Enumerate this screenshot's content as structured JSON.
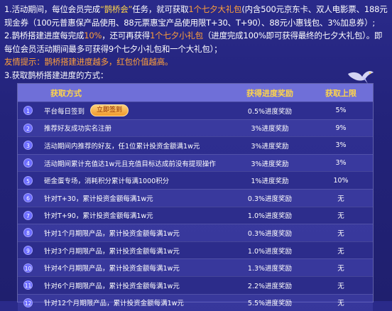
{
  "rules": {
    "line1_a": "1.活动期间，每位会员完成",
    "line1_event": "“鹊桥会”",
    "line1_b": "任务，就可获取",
    "line1_prize": "1个七夕大礼包",
    "line1_c": "(内含500元京东卡、双人电影票、188元现金券（100元普惠保产品使用、88元票惠宝产品使用限T+30、T+90）、88元小惠钱包、3%加息券）;",
    "line2_a": "2.鹊桥搭建进度每完成",
    "line2_pct": "10%",
    "line2_b": "，还可再获得",
    "line2_prize": "1个七夕小礼包",
    "line2_c": "（进度完成100%即可获得最终的七夕大礼包）。即每位会员活动期间最多可获得9个七夕小礼包和一个大礼包）；",
    "tip": "友情提示：鹊桥搭建进度越多，红包价值越高。",
    "line3": "3.获取鹊桥搭建进度的方式："
  },
  "table": {
    "headers": {
      "method": "获取方式",
      "reward": "获得进度奖励",
      "limit": "获取上限"
    },
    "signin_button": "立即签到",
    "rows": [
      {
        "num": "1",
        "method": "平台每日签到",
        "reward": "0.5%进度奖励",
        "limit": "5%"
      },
      {
        "num": "2",
        "method": "推荐好友成功实名注册",
        "reward": "3%进度奖励",
        "limit": "9%"
      },
      {
        "num": "3",
        "method": "活动期间内推荐的好友，任1位累计投资金额满1w元",
        "reward": "3%进度奖励",
        "limit": "3%"
      },
      {
        "num": "4",
        "method": "活动期间累计充值达1w元且充值目标达成前没有提现操作",
        "reward": "3%进度奖励",
        "limit": "3%"
      },
      {
        "num": "5",
        "method": "砸金蛋专场，消耗积分累计每满1000积分",
        "reward": "1%进度奖励",
        "limit": "10%"
      },
      {
        "num": "6",
        "method": "针对T+30，累计投资金额每满1w元",
        "reward": "0.3%进度奖励",
        "limit": "无"
      },
      {
        "num": "7",
        "method": "针对T+90，累计投资金额每满1w元",
        "reward": "1.0%进度奖励",
        "limit": "无"
      },
      {
        "num": "8",
        "method": "针对1个月期限产品，累计投资金额每满1w元",
        "reward": "0.3%进度奖励",
        "limit": "无"
      },
      {
        "num": "9",
        "method": "针对3个月期限产品，累计投资金额每满1w元",
        "reward": "1.0%进度奖励",
        "limit": "无"
      },
      {
        "num": "10",
        "method": "针对4个月期限产品，累计投资金额每满1w元",
        "reward": "1.3%进度奖励",
        "limit": "无"
      },
      {
        "num": "11",
        "method": "针对6个月期限产品，累计投资金额每满1w元",
        "reward": "2.2%进度奖励",
        "limit": "无"
      },
      {
        "num": "12",
        "method": "针对12个月期限产品，累计投资金额每满1w元",
        "reward": "5.5%进度奖励",
        "limit": "无"
      }
    ]
  }
}
